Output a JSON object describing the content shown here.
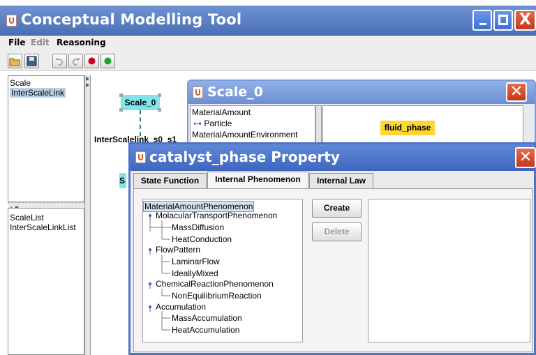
{
  "main_window": {
    "title": "Conceptual Modelling Tool",
    "buttons": {
      "minimize": "_",
      "maximize": "□",
      "close": "X"
    }
  },
  "menubar": {
    "file": "File",
    "edit": "Edit",
    "reasoning": "Reasoning"
  },
  "toolbar": {
    "icons": [
      "open-folder-icon",
      "save-icon",
      "undo-icon",
      "redo-icon",
      "record-red-icon",
      "run-green-icon"
    ]
  },
  "left_panel": {
    "top_list": [
      "Scale",
      "InterScaleLink"
    ],
    "bottom_list": [
      "ScaleList",
      "InterScaleLinkList"
    ]
  },
  "canvas": {
    "scale_node": "Scale_0",
    "link_label": "InterScalelink_s0_s1",
    "partial_node": "S"
  },
  "scale_window": {
    "title": "Scale_0",
    "tree": [
      "MaterialAmount",
      "Particle",
      "MaterialAmountEnvironment"
    ],
    "fluid_node": "fluid_phase"
  },
  "dialog": {
    "title": "catalyst_phase Property",
    "tabs": [
      "State Function",
      "Internal Phenomenon",
      "Internal Law"
    ],
    "active_tab": 1,
    "tree": {
      "root": "MaterialAmountPhenomenon",
      "groups": [
        {
          "label": "MolacularTransportPhenomenon",
          "children": [
            "MassDiffusion",
            "HeatConduction"
          ]
        },
        {
          "label": "FlowPattern",
          "children": [
            "LaminarFlow",
            "IdeallyMixed"
          ]
        },
        {
          "label": "ChemicalReactionPhenomenon",
          "children": [
            "NonEquilibriumReaction"
          ]
        },
        {
          "label": "Accumulation",
          "children": [
            "MassAccumulation",
            "HeatAccumulation"
          ]
        }
      ]
    },
    "create_label": "Create",
    "delete_label": "Delete",
    "close_button": "X"
  },
  "colors": {
    "title_blue": "#4a6fb5",
    "close_red": "#d24a2c",
    "node_cyan": "#7ee6ea",
    "node_yellow": "#ffd633"
  }
}
